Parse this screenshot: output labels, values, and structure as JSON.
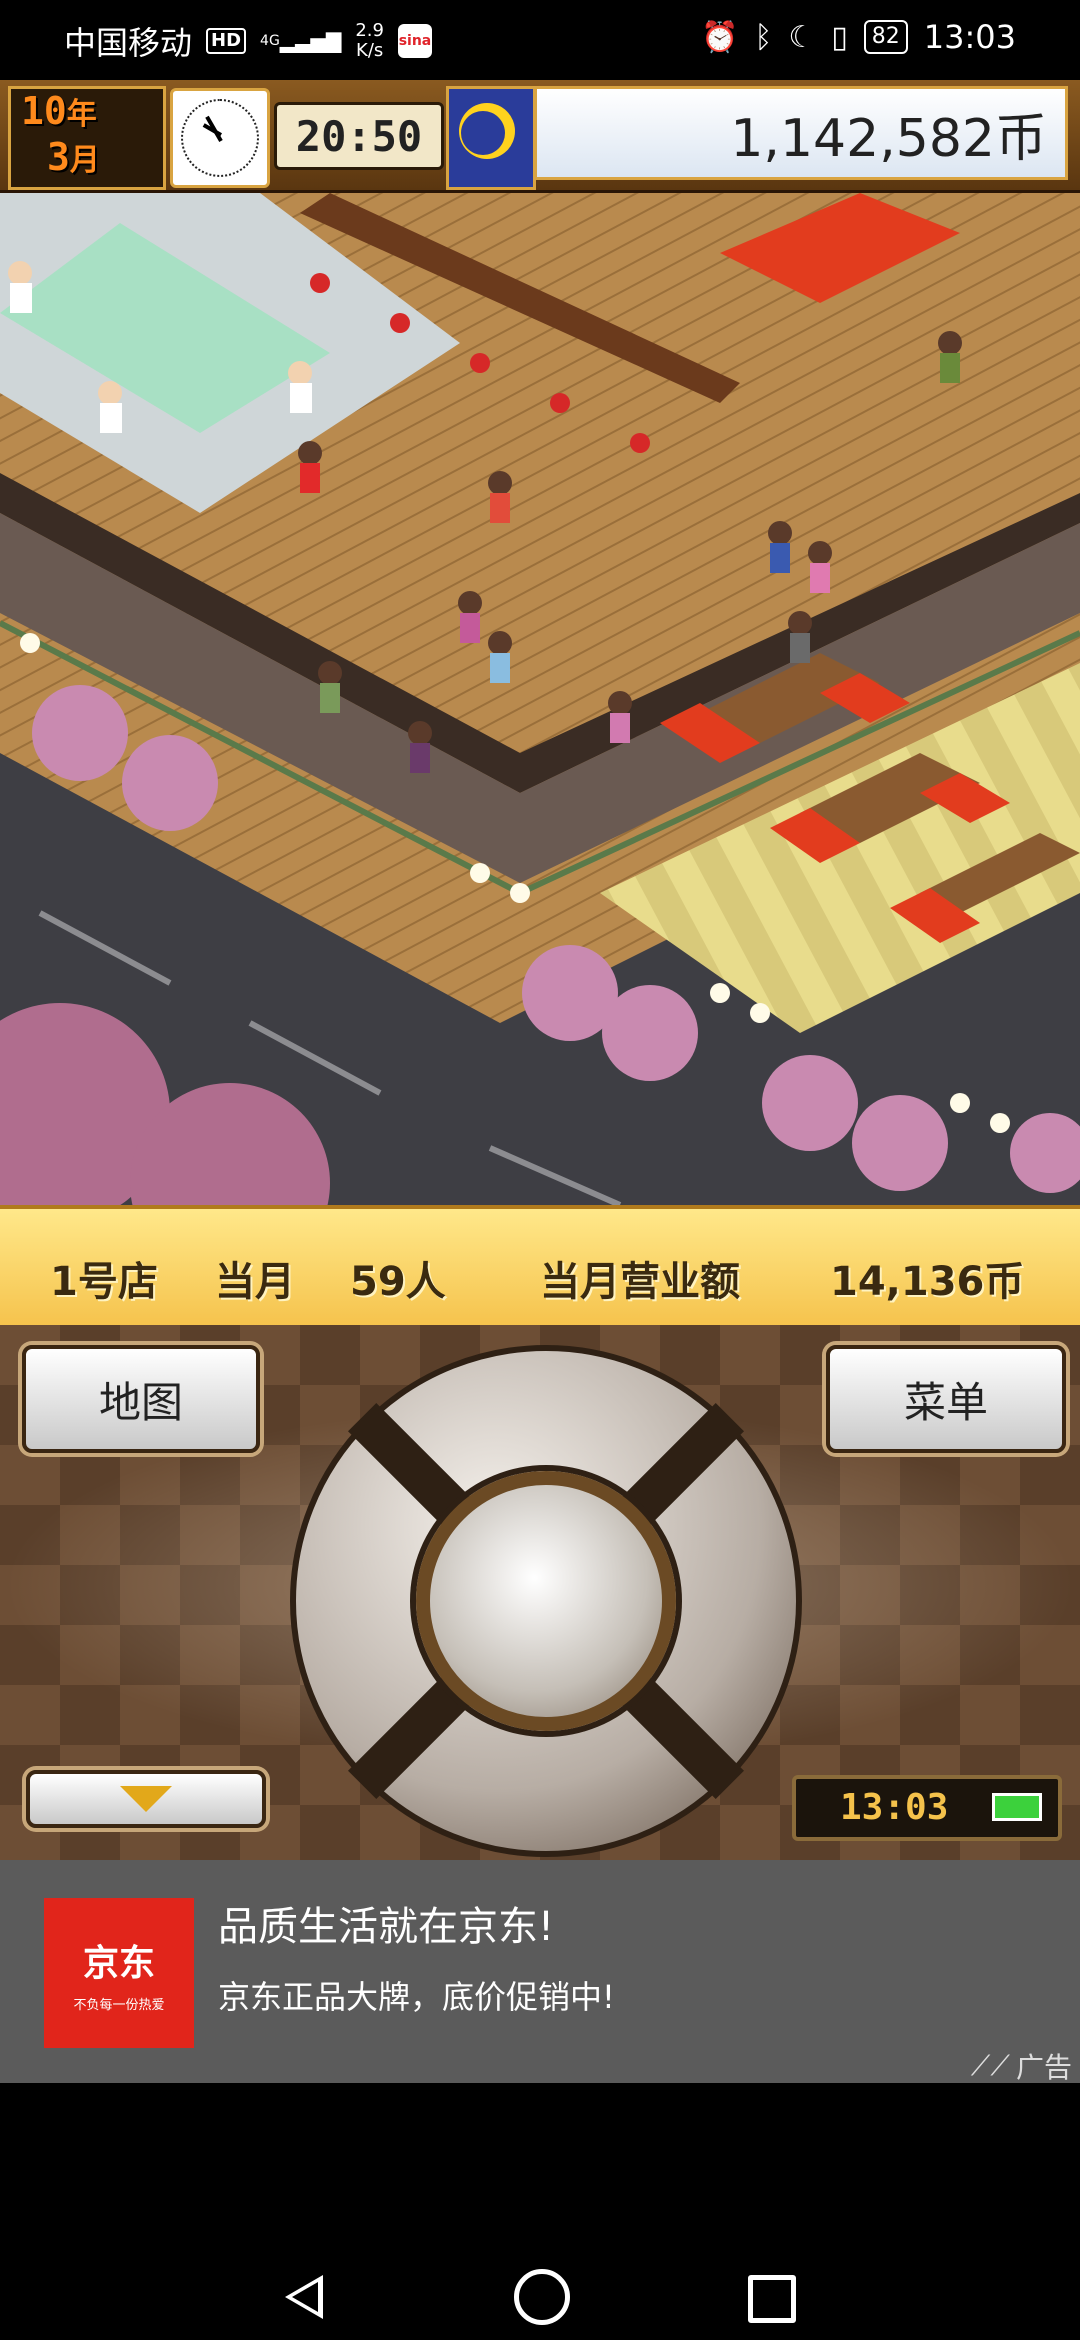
{
  "status_bar": {
    "carrier": "中国移动",
    "hd": "HD",
    "network": "4G",
    "net_speed_value": "2.9",
    "net_speed_unit": "K/s",
    "weibo": "sina",
    "battery": "82",
    "time": "13:03"
  },
  "hud": {
    "year_num": "10",
    "year_unit": "年",
    "month_num": "3",
    "month_unit": "月",
    "game_time": "20:50",
    "money": "1,142,582币"
  },
  "info_bar": {
    "store": "1号店",
    "month_label": "当月",
    "customers": "59人",
    "revenue_label": "当月营业额",
    "revenue": "14,136币"
  },
  "controls": {
    "map_label": "地图",
    "menu_label": "菜单",
    "mini_clock_time": "13:03"
  },
  "ad": {
    "logo_name": "京东",
    "logo_slogan": "不负每一份热爱",
    "title": "品质生活就在京东!",
    "subtitle": "京东正品大牌，底价促销中!",
    "badge": "广告"
  }
}
